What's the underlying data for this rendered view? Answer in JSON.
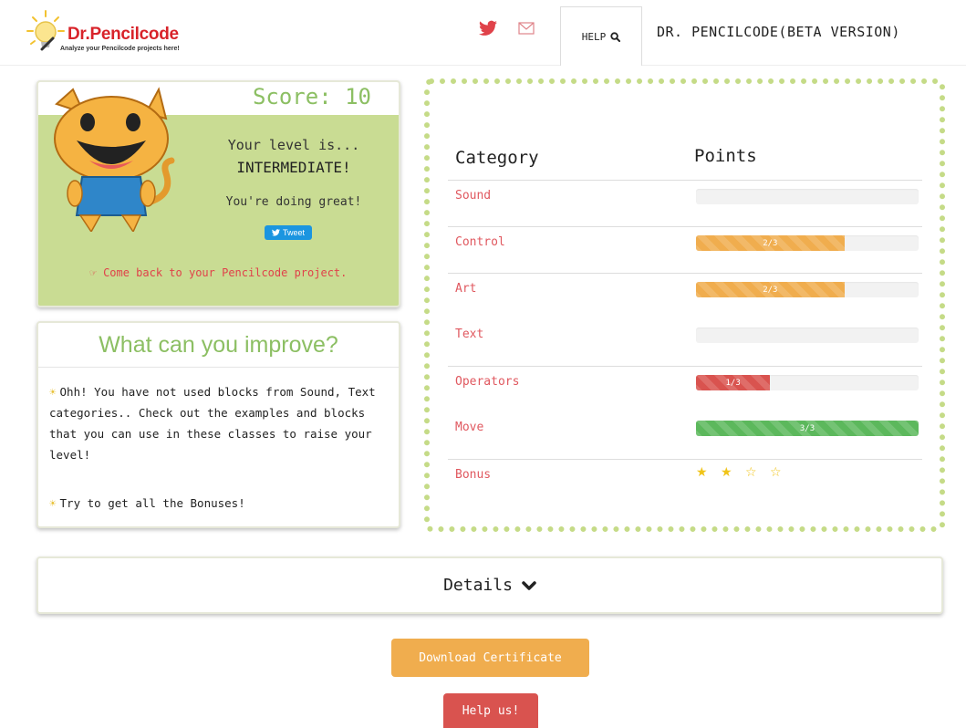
{
  "header": {
    "logo_title": "Dr.Pencilcode",
    "logo_subtitle": "Analyze your Pencilcode projects here!",
    "twitter_icon": "twitter-icon",
    "mail_icon": "mail-icon",
    "help_label": "HELP",
    "help_icon": "search-icon",
    "app_title": "DR. PENCILCODE(BETA VERSION)"
  },
  "score": {
    "title": "Score: 10",
    "level_intro": "Your level is...",
    "level_value": "INTERMEDIATE!",
    "message": "You're doing great!",
    "tweet_label": "Tweet",
    "back_link": "Come back to your Pencilcode project."
  },
  "improve": {
    "title": "What can you improve?",
    "tip1": "Ohh! You have not used blocks from Sound, Text categories.. Check out the examples and blocks that you can use in these classes to raise your level!",
    "tip2": "Try to get all the Bonuses!"
  },
  "categories": {
    "header_category": "Category",
    "header_points": "Points",
    "rows": [
      {
        "name": "Sound",
        "label": "",
        "fraction": 0,
        "color": "#f0ad4e"
      },
      {
        "name": "Control",
        "label": "2/3",
        "fraction": 0.6667,
        "color": "#f0ad4e"
      },
      {
        "name": "Art",
        "label": "2/3",
        "fraction": 0.6667,
        "color": "#f0ad4e"
      },
      {
        "name": "Text",
        "label": "",
        "fraction": 0,
        "color": "#f0ad4e"
      },
      {
        "name": "Operators",
        "label": "1/3",
        "fraction": 0.3333,
        "color": "#d9534f"
      },
      {
        "name": "Move",
        "label": "3/3",
        "fraction": 1,
        "color": "#5cb85c"
      }
    ],
    "bonus_label": "Bonus",
    "bonus_stars": "★ ★ ☆ ☆",
    "bonus_earned": 2,
    "bonus_total": 4
  },
  "details": {
    "label": "Details",
    "icon": "chevron-down-icon"
  },
  "buttons": {
    "certificate": "Download Certificate",
    "help_us": "Help us!"
  }
}
